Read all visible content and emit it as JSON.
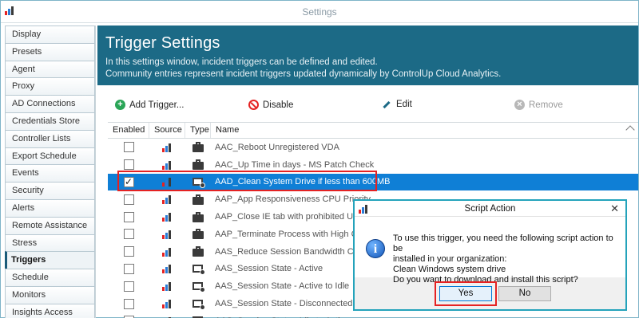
{
  "window": {
    "title": "Settings"
  },
  "colors": {
    "accent": "#1c6a86",
    "selection": "#0f7fd6",
    "highlight": "#e52222",
    "dialog_border": "#24a3bb"
  },
  "sidebar": {
    "items": [
      {
        "label": "Display",
        "active": false
      },
      {
        "label": "Presets",
        "active": false
      },
      {
        "label": "Agent",
        "active": false
      },
      {
        "label": "Proxy",
        "active": false
      },
      {
        "label": "AD Connections",
        "active": false
      },
      {
        "label": "Credentials Store",
        "active": false
      },
      {
        "label": "Controller Lists",
        "active": false
      },
      {
        "label": "Export Schedule",
        "active": false
      },
      {
        "label": "Events",
        "active": false
      },
      {
        "label": "Security",
        "active": false
      },
      {
        "label": "Alerts",
        "active": false
      },
      {
        "label": "Remote Assistance",
        "active": false
      },
      {
        "label": "Stress",
        "active": false
      },
      {
        "label": "Triggers",
        "active": true
      },
      {
        "label": "Schedule",
        "active": false
      },
      {
        "label": "Monitors",
        "active": false
      },
      {
        "label": "Insights Access",
        "active": false
      }
    ]
  },
  "header": {
    "title": "Trigger Settings",
    "line1": "In this settings window, incident triggers can be defined and edited.",
    "line2": "Community entries represent incident triggers updated dynamically by ControlUp Cloud Analytics."
  },
  "toolbar": {
    "add_label": "Add Trigger...",
    "disable_label": "Disable",
    "edit_label": "Edit",
    "remove_label": "Remove"
  },
  "grid": {
    "columns": {
      "enabled": "Enabled",
      "source": "Source",
      "type": "Type",
      "name": "Name"
    },
    "rows": [
      {
        "name": "AAC_Reboot Unregistered VDA",
        "checked": false,
        "type": "briefcase",
        "selected": false
      },
      {
        "name": "AAC_Up Time in days - MS Patch Check",
        "checked": false,
        "type": "briefcase",
        "selected": false
      },
      {
        "name": "AAD_Clean System Drive if less than 600MB",
        "checked": true,
        "type": "screen",
        "selected": true
      },
      {
        "name": "AAP_App Responsiveness CPU Priority",
        "checked": false,
        "type": "briefcase",
        "selected": false
      },
      {
        "name": "AAP_Close IE tab with prohibited URL",
        "checked": false,
        "type": "briefcase",
        "selected": false
      },
      {
        "name": "AAP_Terminate Process with High CPU",
        "checked": false,
        "type": "briefcase",
        "selected": false
      },
      {
        "name": "AAS_Reduce Session Bandwidth Consumption",
        "checked": false,
        "type": "briefcase",
        "selected": false
      },
      {
        "name": "AAS_Session State - Active",
        "checked": false,
        "type": "screen",
        "selected": false
      },
      {
        "name": "AAS_Session State - Active to Idle",
        "checked": false,
        "type": "screen",
        "selected": false
      },
      {
        "name": "AAS_Session State - Disconnected",
        "checked": false,
        "type": "screen",
        "selected": false
      },
      {
        "name": "AAS_Session State - Idle to Active",
        "checked": false,
        "type": "screen",
        "selected": false
      }
    ]
  },
  "dialog": {
    "title": "Script Action",
    "close_glyph": "✕",
    "info_glyph": "i",
    "text_line1": "To use this trigger, you need the following script action to be",
    "text_line2": "installed in your organization:",
    "text_line3": "Clean Windows system drive",
    "text_line4": "Do you want to download and install this script?",
    "yes_label": "Yes",
    "no_label": "No"
  }
}
